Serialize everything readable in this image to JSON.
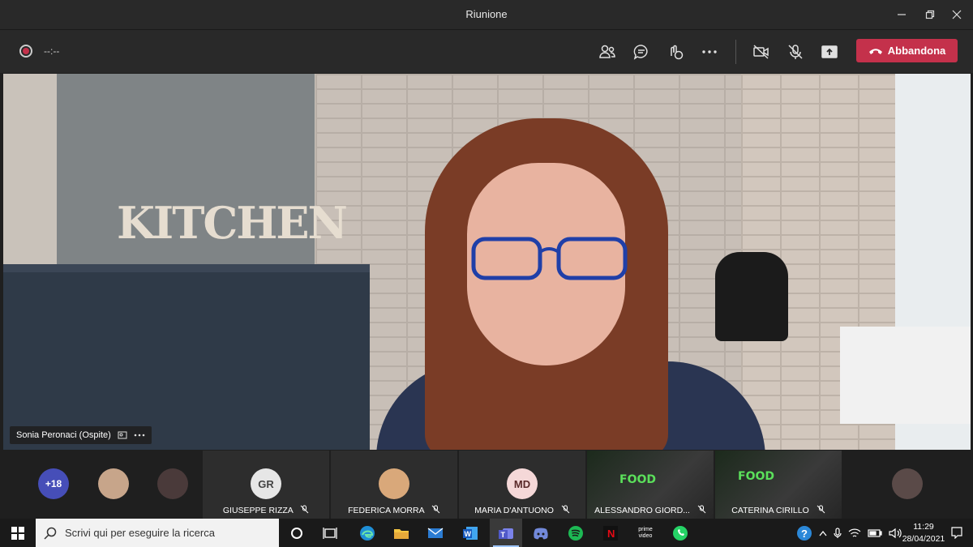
{
  "window": {
    "title": "Riunione"
  },
  "toolbar": {
    "timer": "--:--",
    "leave_label": "Abbandona",
    "icons": [
      "participants-icon",
      "chat-icon",
      "reactions-icon",
      "more-icon",
      "camera-off-icon",
      "mic-off-icon",
      "share-icon"
    ]
  },
  "main_video": {
    "name_tag": "Sonia Peronaci (Ospite)",
    "sign_text": "KITCHEN"
  },
  "participants": {
    "more_count": "+18",
    "tiles": [
      {
        "initials": "GR",
        "name": "GIUSEPPE RIZZA"
      },
      {
        "initials": "",
        "name": "FEDERICA MORRA"
      },
      {
        "initials": "MD",
        "name": "MARIA D'ANTUONO"
      },
      {
        "initials": "",
        "name": "ALESSANDRO GIORD..."
      },
      {
        "initials": "",
        "name": "CATERINA CIRILLO"
      }
    ],
    "video_overlay_text": "FOOD"
  },
  "taskbar": {
    "search_placeholder": "Scrivi qui per eseguire la ricerca",
    "time": "11:29",
    "date": "28/04/2021",
    "prime_label": "prime video"
  },
  "colors": {
    "leave": "#c4314b",
    "teams_purple": "#464eb8",
    "avatar_bg": "#e6e6e6"
  }
}
